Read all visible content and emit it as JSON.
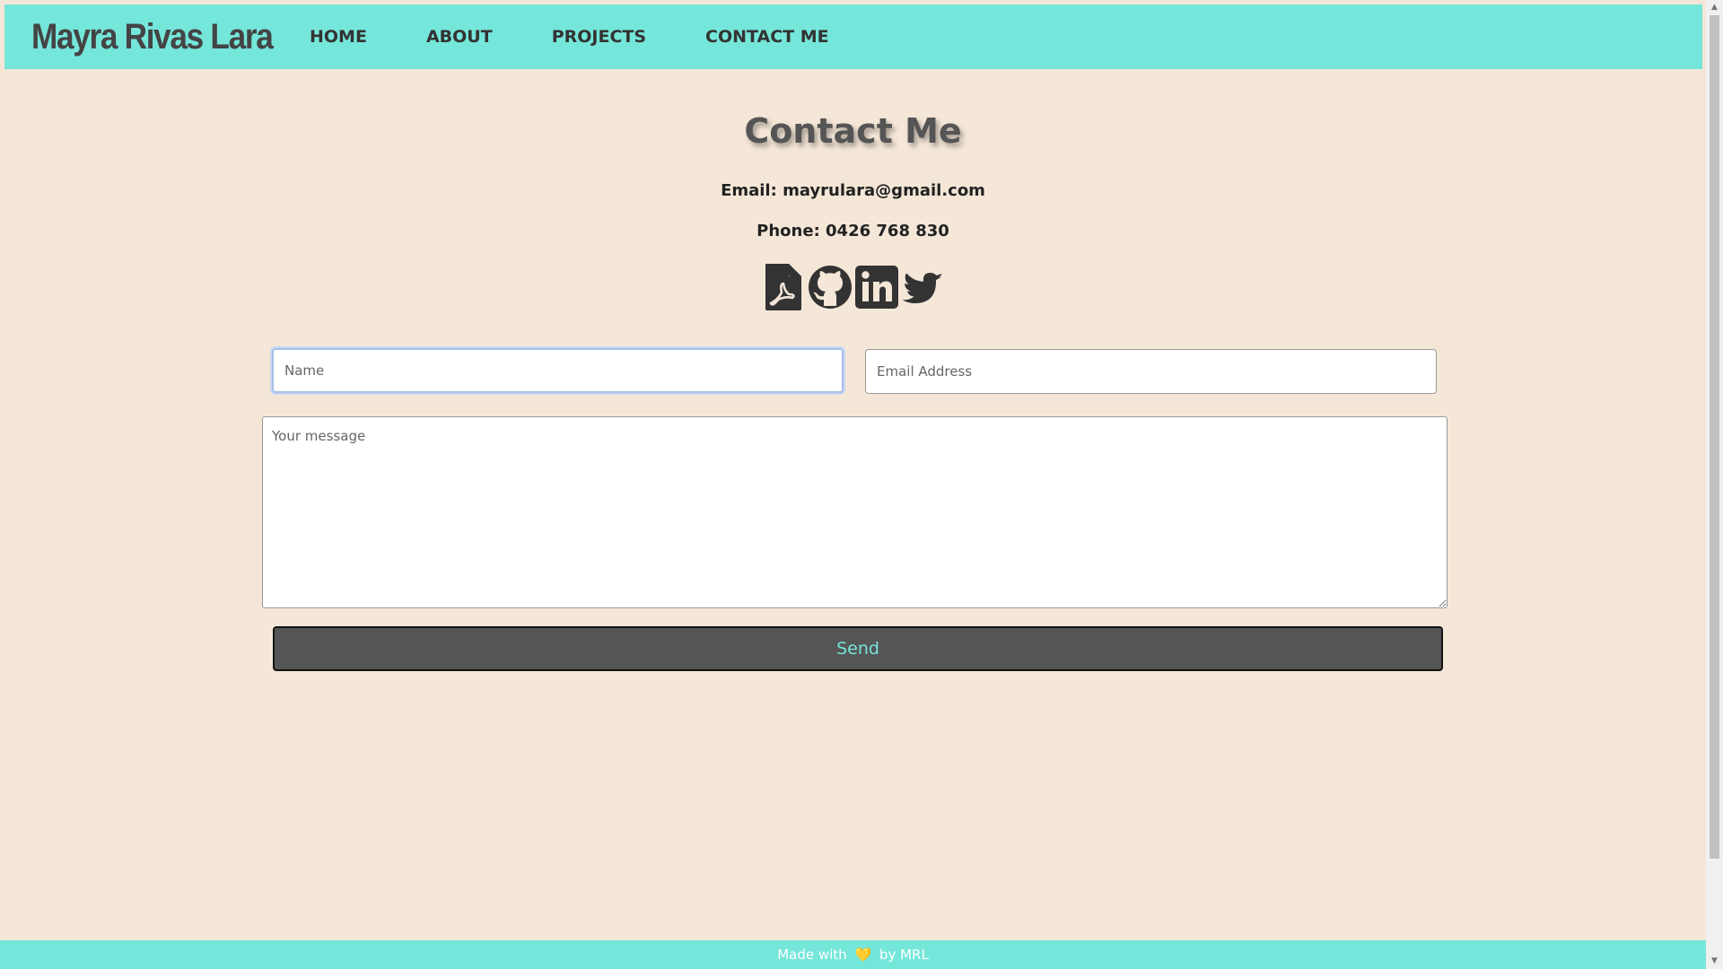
{
  "nav": {
    "brand": "Mayra Rivas Lara",
    "links": [
      "HOME",
      "ABOUT",
      "PROJECTS",
      "CONTACT ME"
    ]
  },
  "main": {
    "title": "Contact Me",
    "email_line": "Email: mayrulara@gmail.com",
    "phone_line": "Phone: 0426 768 830",
    "social_icons": [
      "pdf-resume-icon",
      "github-icon",
      "linkedin-icon",
      "twitter-icon"
    ]
  },
  "form": {
    "name_placeholder": "Name",
    "email_placeholder": "Email Address",
    "message_placeholder": "Your message",
    "send_label": "Send"
  },
  "footer": {
    "prefix": "Made with",
    "heart": "💛",
    "suffix": "by MRL"
  },
  "colors": {
    "accent": "#75e6da",
    "background": "#f5e7d8",
    "button": "#555555",
    "heart": "#f4d03f"
  }
}
